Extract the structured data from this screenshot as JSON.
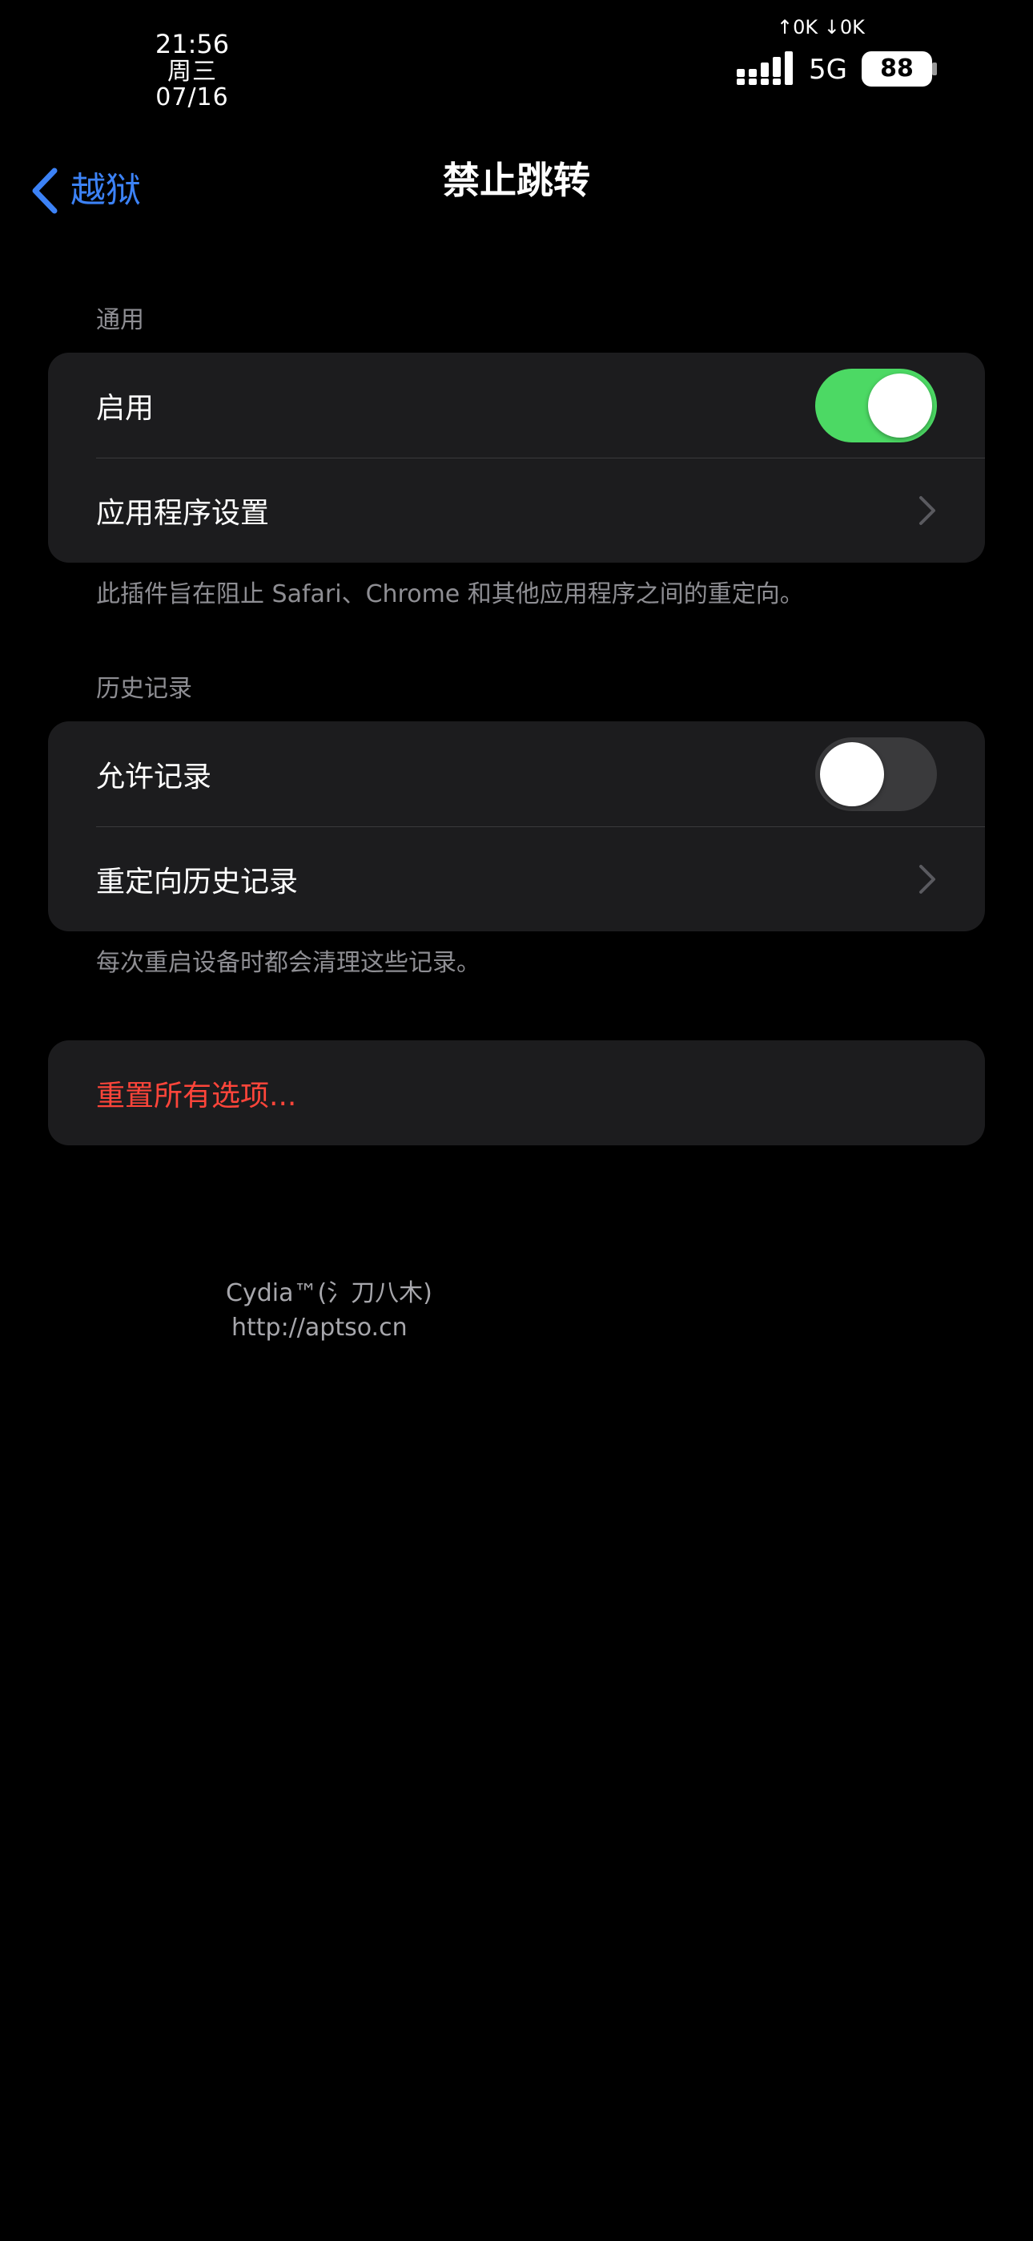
{
  "status_bar": {
    "time": "21:56",
    "date": "周三 07/16",
    "net_speed": "↑0K ↓0K",
    "network": "5G",
    "battery": "88"
  },
  "nav": {
    "back_label": "越狱",
    "title": "禁止跳转"
  },
  "sections": {
    "general": {
      "header": "通用",
      "enable_label": "启用",
      "enable_on": true,
      "app_settings_label": "应用程序设置",
      "footer": "此插件旨在阻止 Safari、Chrome 和其他应用程序之间的重定向。"
    },
    "history": {
      "header": "历史记录",
      "allow_label": "允许记录",
      "allow_on": false,
      "redirect_history_label": "重定向历史记录",
      "footer": "每次重启设备时都会清理这些记录。"
    },
    "reset": {
      "label": "重置所有选项..."
    }
  },
  "credit": {
    "line1": "Cydia™(氵刀八木)",
    "line2": "http://aptso.cn"
  },
  "colors": {
    "accent_blue": "#3C82F6",
    "toggle_on": "#4CD964",
    "destructive": "#FF453A",
    "card": "#1C1C1E"
  },
  "icons": [
    "signal-bars-icon",
    "chevron-left-icon",
    "chevron-right-icon"
  ]
}
